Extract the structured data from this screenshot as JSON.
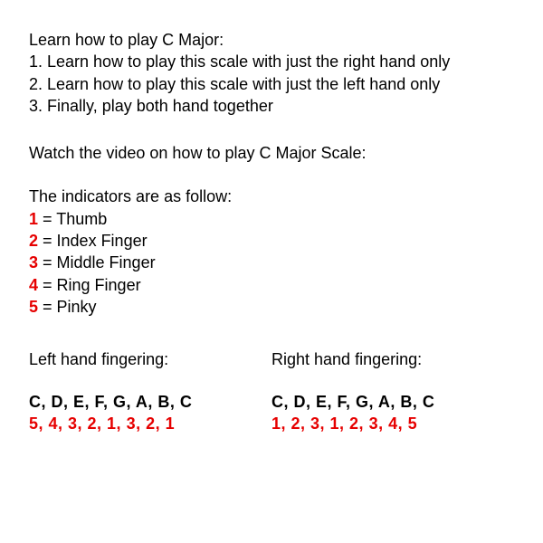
{
  "intro_heading": "Learn how to play C Major:",
  "steps": [
    "1. Learn how to play this scale with just the right hand only",
    "2. Learn how to play this scale with just the left hand only",
    "3. Finally, play both hand together"
  ],
  "video_line": "Watch the video on how to play C Major Scale:",
  "indicators_heading": "The indicators are as follow:",
  "indicators": [
    {
      "num": "1",
      "label": " = Thumb"
    },
    {
      "num": "2",
      "label": " = Index Finger"
    },
    {
      "num": "3",
      "label": " = Middle Finger"
    },
    {
      "num": "4",
      "label": " = Ring Finger"
    },
    {
      "num": "5",
      "label": " = Pinky"
    }
  ],
  "left": {
    "title": "Left hand fingering:",
    "notes": "C, D, E, F, G, A, B, C",
    "fingering": "5, 4, 3, 2, 1, 3, 2, 1"
  },
  "right": {
    "title": "Right hand fingering:",
    "notes": "C, D, E, F, G, A, B, C",
    "fingering": "1, 2, 3, 1, 2, 3, 4, 5"
  }
}
